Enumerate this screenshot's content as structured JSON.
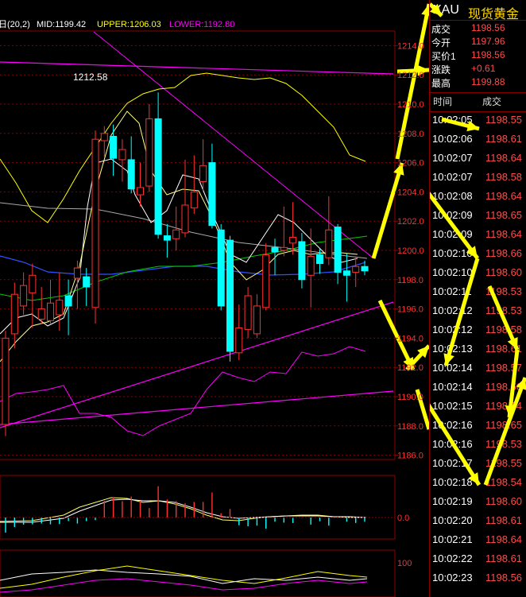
{
  "legend": {
    "prefix": "日(20,2)",
    "mid": "MID:1199.42",
    "upper": "UPPER:1206.03",
    "lower": "LOWER:1192.80",
    "colors": {
      "prefix": "#ffffff",
      "mid": "#ffffff",
      "upper": "#ffff00",
      "lower": "#ff00ff"
    }
  },
  "header": {
    "symbol": "XAU",
    "name": "现货黄金"
  },
  "quote": [
    {
      "label": "成交",
      "value": "1198.56"
    },
    {
      "label": "今开",
      "value": "1197.96"
    },
    {
      "label": "买价1",
      "value": "1198.56"
    },
    {
      "label": "涨跌",
      "value": "+0.61"
    },
    {
      "label": "最高",
      "value": "1199.88"
    }
  ],
  "ticks_header": {
    "time": "时间",
    "price": "成交"
  },
  "ticks": [
    {
      "time": "10:02:05",
      "price": "1198.55"
    },
    {
      "time": "10:02:06",
      "price": "1198.61"
    },
    {
      "time": "10:02:07",
      "price": "1198.64"
    },
    {
      "time": "10:02:07",
      "price": "1198.58"
    },
    {
      "time": "10:02:08",
      "price": "1198.64"
    },
    {
      "time": "10:02:09",
      "price": "1198.65"
    },
    {
      "time": "10:02:09",
      "price": "1198.64"
    },
    {
      "time": "10:02:10",
      "price": "1198.66"
    },
    {
      "time": "10:02:10",
      "price": "1198.60"
    },
    {
      "time": "10:02:11",
      "price": "1198.53"
    },
    {
      "time": "10:02:12",
      "price": "1198.53"
    },
    {
      "time": "10:02:12",
      "price": "1198.58"
    },
    {
      "time": "10:02:13",
      "price": "1198.61"
    },
    {
      "time": "10:02:14",
      "price": "1198.57"
    },
    {
      "time": "10:02:14",
      "price": "1198.56"
    },
    {
      "time": "10:02:15",
      "price": "1198.64"
    },
    {
      "time": "10:02:16",
      "price": "1198.65"
    },
    {
      "time": "10:02:16",
      "price": "1198.53"
    },
    {
      "time": "10:02:17",
      "price": "1198.55"
    },
    {
      "time": "10:02:18",
      "price": "1198.54"
    },
    {
      "time": "10:02:19",
      "price": "1198.60"
    },
    {
      "time": "10:02:20",
      "price": "1198.61"
    },
    {
      "time": "10:02:21",
      "price": "1198.64"
    },
    {
      "time": "10:02:22",
      "price": "1198.61"
    },
    {
      "time": "10:02:23",
      "price": "1198.56"
    }
  ],
  "chart_data": {
    "type": "candlestick",
    "ylim": [
      1185,
      1215
    ],
    "y_ticks": [
      "1186.0",
      "1188.0",
      "1190.0",
      "1192.0",
      "1194.0",
      "1196.0",
      "1198.0",
      "1200.0",
      "1202.0",
      "1204.0",
      "1206.0",
      "1208.0",
      "1210.0",
      "1212.0",
      "1214.0"
    ],
    "annotation": {
      "text": "1212.58",
      "value": 1212.58
    },
    "macd_ticks": [
      "0.0"
    ],
    "osc_ticks": [
      "100"
    ],
    "colors": {
      "up": "#ff3030",
      "down": "#00ffff",
      "grid": "#8a0000",
      "axis_text": "#ff3030",
      "arrow": "#ffff00"
    },
    "candles": [
      {
        "o": 1188.1,
        "c": 1194.0,
        "h": 1194.5,
        "l": 1187.3
      },
      {
        "o": 1194.3,
        "c": 1197.0,
        "h": 1197.8,
        "l": 1193.3
      },
      {
        "o": 1196.2,
        "c": 1197.6,
        "h": 1198.5,
        "l": 1195.6
      },
      {
        "o": 1197.1,
        "c": 1198.3,
        "h": 1199.1,
        "l": 1194.7
      },
      {
        "o": 1195.3,
        "c": 1196.0,
        "h": 1197.5,
        "l": 1195.0
      },
      {
        "o": 1195.2,
        "c": 1196.4,
        "h": 1198.0,
        "l": 1195.0
      },
      {
        "o": 1195.6,
        "c": 1196.6,
        "h": 1198.5,
        "l": 1194.5
      },
      {
        "o": 1196.9,
        "c": 1196.2,
        "h": 1198.0,
        "l": 1194.2
      },
      {
        "o": 1198.1,
        "c": 1198.8,
        "h": 1199.3,
        "l": 1196.0
      },
      {
        "o": 1198.2,
        "c": 1197.5,
        "h": 1198.8,
        "l": 1196.2
      },
      {
        "o": 1196.1,
        "c": 1207.6,
        "h": 1208.2,
        "l": 1195.0
      },
      {
        "o": 1207.5,
        "c": 1208.0,
        "h": 1208.5,
        "l": 1206.4
      },
      {
        "o": 1207.8,
        "c": 1206.3,
        "h": 1208.6,
        "l": 1205.1
      },
      {
        "o": 1206.2,
        "c": 1206.9,
        "h": 1207.6,
        "l": 1204.7
      },
      {
        "o": 1206.2,
        "c": 1204.2,
        "h": 1207.8,
        "l": 1203.9
      },
      {
        "o": 1203.8,
        "c": 1204.3,
        "h": 1206.0,
        "l": 1203.0
      },
      {
        "o": 1204.4,
        "c": 1209.0,
        "h": 1210.0,
        "l": 1204.0
      },
      {
        "o": 1209.0,
        "c": 1201.1,
        "h": 1210.8,
        "l": 1200.8
      },
      {
        "o": 1201.0,
        "c": 1200.7,
        "h": 1201.8,
        "l": 1199.5
      },
      {
        "o": 1200.8,
        "c": 1201.4,
        "h": 1203.0,
        "l": 1200.0
      },
      {
        "o": 1201.2,
        "c": 1203.1,
        "h": 1206.2,
        "l": 1200.9
      },
      {
        "o": 1202.9,
        "c": 1204.0,
        "h": 1206.5,
        "l": 1202.5
      },
      {
        "o": 1204.7,
        "c": 1205.8,
        "h": 1207.6,
        "l": 1204.1
      },
      {
        "o": 1206.0,
        "c": 1201.7,
        "h": 1207.3,
        "l": 1201.5
      },
      {
        "o": 1201.4,
        "c": 1196.2,
        "h": 1201.8,
        "l": 1195.9
      },
      {
        "o": 1200.7,
        "c": 1193.1,
        "h": 1201.0,
        "l": 1192.4
      },
      {
        "o": 1193.0,
        "c": 1194.7,
        "h": 1196.3,
        "l": 1192.5
      },
      {
        "o": 1194.6,
        "c": 1196.9,
        "h": 1197.5,
        "l": 1194.0
      },
      {
        "o": 1194.3,
        "c": 1196.2,
        "h": 1197.0,
        "l": 1194.0
      },
      {
        "o": 1196.1,
        "c": 1199.7,
        "h": 1200.5,
        "l": 1195.9
      },
      {
        "o": 1200.2,
        "c": 1199.9,
        "h": 1200.8,
        "l": 1198.3
      },
      {
        "o": 1200.0,
        "c": 1200.2,
        "h": 1203.0,
        "l": 1199.6
      },
      {
        "o": 1200.5,
        "c": 1200.9,
        "h": 1203.3,
        "l": 1199.7
      },
      {
        "o": 1200.6,
        "c": 1198.0,
        "h": 1201.2,
        "l": 1197.4
      },
      {
        "o": 1198.3,
        "c": 1199.6,
        "h": 1201.5,
        "l": 1196.1
      },
      {
        "o": 1199.7,
        "c": 1199.1,
        "h": 1200.1,
        "l": 1198.4
      },
      {
        "o": 1199.5,
        "c": 1201.4,
        "h": 1203.7,
        "l": 1199.0
      },
      {
        "o": 1201.6,
        "c": 1198.5,
        "h": 1201.8,
        "l": 1197.7
      },
      {
        "o": 1198.6,
        "c": 1198.3,
        "h": 1199.8,
        "l": 1196.5
      },
      {
        "o": 1198.5,
        "c": 1198.9,
        "h": 1199.6,
        "l": 1197.5
      },
      {
        "o": 1198.9,
        "c": 1198.6,
        "h": 1199.3,
        "l": 1198.3
      }
    ]
  }
}
